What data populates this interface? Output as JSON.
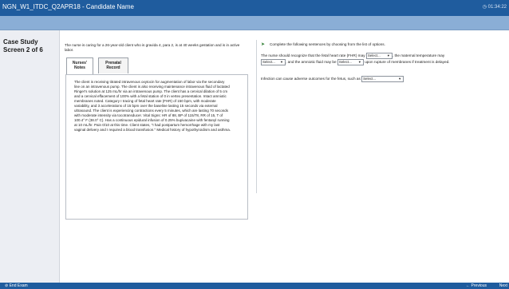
{
  "header": {
    "title": "NGN_W1_ITDC_Q2APR18 - Candidate Name",
    "timer": "◷ 01:34:22"
  },
  "sidebar": {
    "case_label": "Case Study",
    "case_progress": "Screen 2 of 6"
  },
  "intro": "The nurse is caring for a 26-year-old client who is gravida 4, para 2, is at 40 weeks gestation and is in active labor.",
  "tabs": [
    {
      "label": "Nurses' Notes",
      "active": true
    },
    {
      "label": "Prenatal Record",
      "active": false
    }
  ],
  "notes": "The client is receiving titrated intravenous oxytocin for augmentation of labor via the secondary line on an intravenous pump. The client is also receiving maintenance intravenous fluid of lactated Ringer's solution at 125 mL/hr via an intravenous pump. The client has a cervical dilation of 5 cm and a cervical effacement of 100% with a fetal station of 0 in vertex presentation. Intact amniotic membranes noted. Category I tracing of fetal heart rate (FHR) of 150 bpm, with moderate variability, and 3 accelerations of 15 bpm over the baseline lasting 15 seconds via external ultrasound. The client is experiencing contractions every 5 minutes, which are lasting 70 seconds with moderate intensity via tocotransducer. Vital Signs: HR of 88, BP of 115/78, RR of 15, T of 100.4° F (38.0° C). Has a continuous epidural infusion of 0.25% bupivacaine with fentanyl running at 10 mL/hr. Pain 0/10 at this time. Client states, \"I had postpartum hemorrhage with my last vaginal delivery and I required a blood transfusion.\" Medical history of hypothyroidism and asthma.",
  "question": {
    "instruction": "Complete the following sentences by choosing from the list of options.",
    "s1_part1": "The nurse should recognize that the fetal heart rate (FHR) may",
    "s1_part2": ", the maternal temperature may",
    "s1_part3": ", and the amniotic fluid may be",
    "s1_part4": "upon rupture of membranes if treatment is delayed.",
    "s2_part1": "Infection can cause adverse outcomes for the fetus, such as",
    "select_placeholder": "Select..."
  },
  "footer": {
    "end_exam": "⊘ End Exam",
    "previous": "← Previous",
    "next": "Next"
  }
}
